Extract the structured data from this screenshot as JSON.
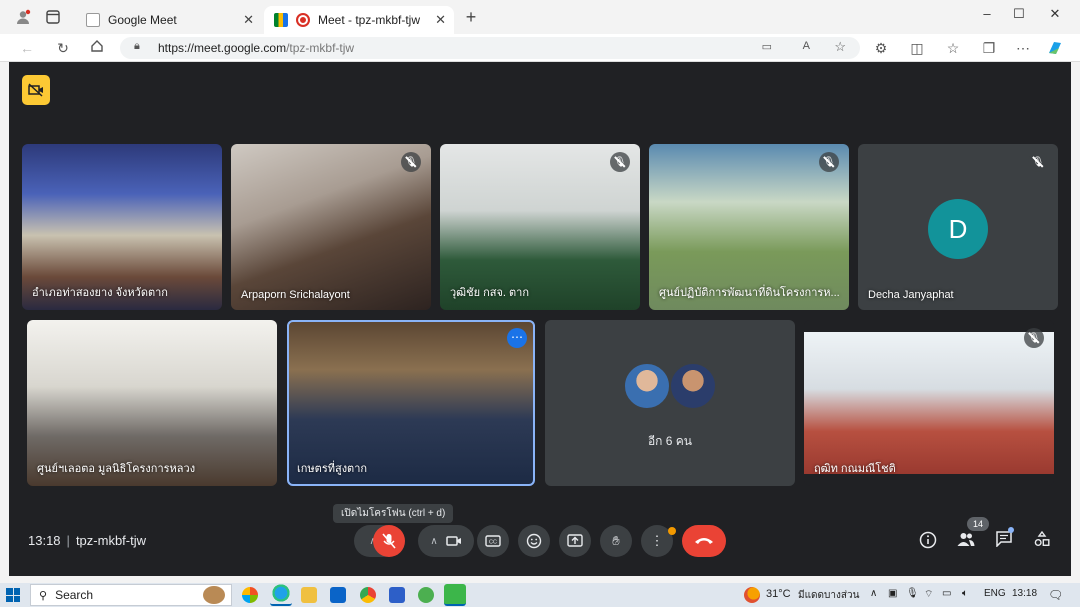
{
  "browser": {
    "tabs": [
      {
        "label": "Google Meet",
        "active": false
      },
      {
        "label": "Meet - tpz-mkbf-tjw",
        "active": true
      }
    ],
    "new_tab": "+",
    "window_controls": [
      "–",
      "☐",
      "✕"
    ],
    "url_domain": "https://meet.google.com",
    "url_path": "/tpz-mkbf-tjw"
  },
  "participants": [
    {
      "name": "อำเภอท่าสองยาง จังหวัดตาก",
      "muted": false
    },
    {
      "name": "Arpaporn Srichalayont",
      "muted": true
    },
    {
      "name": "วุฒิชัย กสจ. ตาก",
      "muted": true
    },
    {
      "name": "ศูนย์ปฏิบัติการพัฒนาที่ดินโครงการห...",
      "muted": true
    },
    {
      "name": "Decha Janyaphat",
      "muted": true,
      "avatar_letter": "D",
      "avatar_color": "#12939a"
    },
    {
      "name": "ศูนย์ฯเลอตอ มูลนิธิโครงการหลวง",
      "muted": false
    },
    {
      "name": "เกษตรที่สูงตาก",
      "muted": false
    },
    {
      "name": "ฤฒิท กณมณีโชติ",
      "muted": true
    }
  ],
  "others_tile": {
    "label": "อีก 6 คน"
  },
  "controls": {
    "tooltip": "เปิดไมโครโฟน (ctrl + d)",
    "time": "13:18",
    "meeting_code": "tpz-mkbf-tjw",
    "people_count": "14",
    "end_call_color": "#ea4335"
  },
  "taskbar": {
    "search_placeholder": "Search",
    "temperature": "31°C",
    "weather_text": "มีแดดบางส่วน",
    "language": "ENG",
    "clock": "13:18"
  }
}
